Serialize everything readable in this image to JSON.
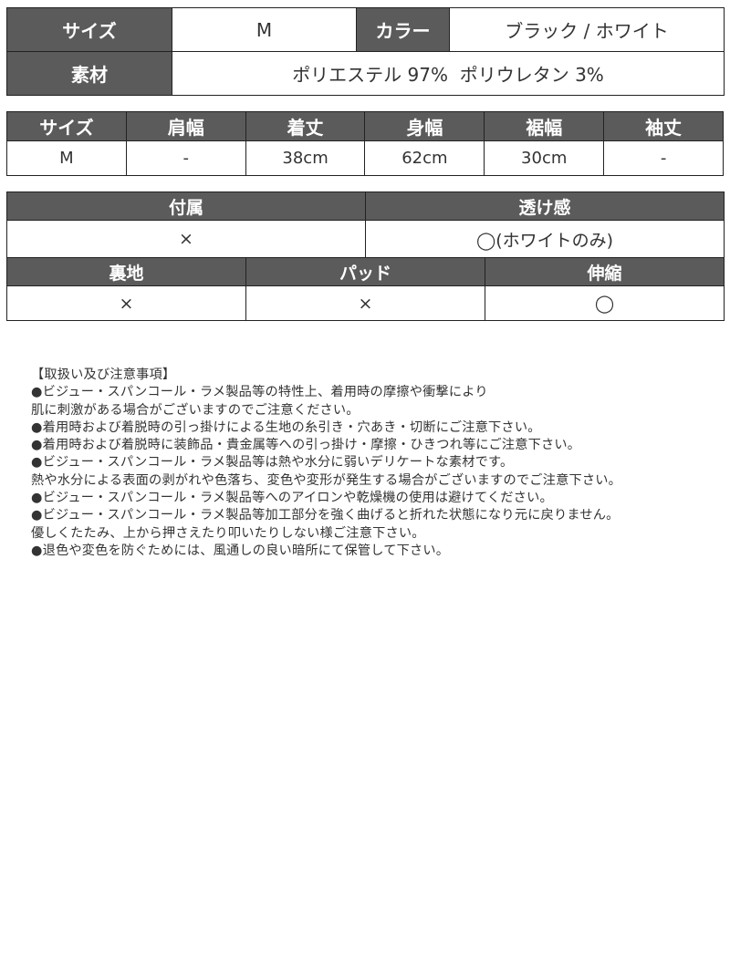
{
  "spec_table": {
    "size_label": "サイズ",
    "size_value": "M",
    "color_label": "カラー",
    "color_value": "ブラック / ホワイト",
    "material_label": "素材",
    "material_value": "ポリエステル 97%  ポリウレタン 3%"
  },
  "size_table": {
    "headers": [
      "サイズ",
      "肩幅",
      "着丈",
      "身幅",
      "裾幅",
      "袖丈"
    ],
    "rows": [
      [
        "M",
        "-",
        "38cm",
        "62cm",
        "30cm",
        "-"
      ]
    ]
  },
  "feature_table": {
    "accessories_label": "付属",
    "accessories_value": "×",
    "sheerness_label": "透け感",
    "sheerness_value": "◯(ホワイトのみ)",
    "lining_label": "裏地",
    "lining_value": "×",
    "pad_label": "パッド",
    "pad_value": "×",
    "stretch_label": "伸縮",
    "stretch_value": "◯"
  },
  "notes": {
    "title": "【取扱い及び注意事項】",
    "lines": [
      "●ビジュー・スパンコール・ラメ製品等の特性上、着用時の摩擦や衝撃により",
      "肌に刺激がある場合がございますのでご注意ください。",
      "●着用時および着脱時の引っ掛けによる生地の糸引き・穴あき・切断にご注意下さい。",
      "●着用時および着脱時に装飾品・貴金属等への引っ掛け・摩擦・ひきつれ等にご注意下さい。",
      "●ビジュー・スパンコール・ラメ製品等は熱や水分に弱いデリケートな素材です。",
      "熱や水分による表面の剥がれや色落ち、変色や変形が発生する場合がございますのでご注意下さい。",
      "●ビジュー・スパンコール・ラメ製品等へのアイロンや乾燥機の使用は避けてください。",
      "●ビジュー・スパンコール・ラメ製品等加工部分を強く曲げると折れた状態になり元に戻りません。",
      "優しくたたみ、上から押さえたり叩いたりしない様ご注意下さい。",
      "●退色や変色を防ぐためには、風通しの良い暗所にて保管して下さい。"
    ]
  }
}
